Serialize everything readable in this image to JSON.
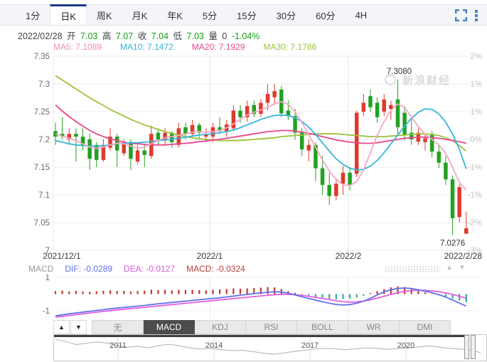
{
  "tabbar": {
    "tabs": [
      "1分",
      "日K",
      "周K",
      "月K",
      "年K",
      "5分",
      "15分",
      "30分",
      "60分",
      "4H"
    ],
    "active_index": 1
  },
  "icons": {
    "fullscreen": "fullscreen-icon",
    "menu": "kebab-menu-icon",
    "color": "#4b80c2"
  },
  "info_bar": {
    "date": "2022/02/28",
    "open_label": "开",
    "open": "7.03",
    "high_label": "高",
    "high": "7.07",
    "close_label": "收",
    "close": "7.04",
    "low_label": "低",
    "low": "7.03",
    "volume_label": "量",
    "volume": "0",
    "change": "-1.04%"
  },
  "ma_legend": [
    {
      "text": "MA5: 7.1089",
      "color": "#f08cb4"
    },
    {
      "text": "MA10: 7.1472",
      "color": "#34b3da"
    },
    {
      "text": "MA20: 7.1929",
      "color": "#e8468c"
    },
    {
      "text": "MA30: 7.1786",
      "color": "#9cc33c"
    }
  ],
  "chart_data": {
    "type": "candlestick",
    "y_axis_left": [
      "7.35",
      "7.3",
      "7.25",
      "7.2",
      "7.15",
      "7.1",
      "7.05",
      "7"
    ],
    "y_axis_right": [
      "2%",
      "1%",
      "1%",
      "0%",
      "-1%",
      "-1%",
      "-2%",
      "-3%"
    ],
    "price_top": 7.35,
    "price_bottom": 7.0,
    "x_labels": [
      "2021/12/1",
      "2022/1",
      "2022/2",
      "2022/2/28"
    ],
    "watermark": "新浪财经",
    "annotation_high": {
      "text": "7.3080",
      "index": 50,
      "value": 7.308
    },
    "annotation_low": {
      "text": "7.0276",
      "index": 58,
      "value": 7.0276
    },
    "colors": {
      "up": "#df3a2e",
      "down": "#22a122",
      "ma5": "#f5a8c4",
      "ma10": "#38b4dc",
      "ma20": "#e8468c",
      "ma30": "#9cc33c"
    },
    "candles": [
      [
        7.215,
        7.23,
        7.19,
        7.205
      ],
      [
        7.21,
        7.24,
        7.2,
        7.205
      ],
      [
        7.2,
        7.22,
        7.19,
        7.21
      ],
      [
        7.21,
        7.22,
        7.16,
        7.205
      ],
      [
        7.205,
        7.22,
        7.18,
        7.19
      ],
      [
        7.2,
        7.21,
        7.145,
        7.165
      ],
      [
        7.19,
        7.195,
        7.15,
        7.163
      ],
      [
        7.163,
        7.2,
        7.16,
        7.19
      ],
      [
        7.185,
        7.22,
        7.18,
        7.205
      ],
      [
        7.205,
        7.21,
        7.15,
        7.18
      ],
      [
        7.175,
        7.2,
        7.17,
        7.195
      ],
      [
        7.195,
        7.2,
        7.145,
        7.165
      ],
      [
        7.16,
        7.19,
        7.155,
        7.18
      ],
      [
        7.18,
        7.19,
        7.15,
        7.172
      ],
      [
        7.17,
        7.225,
        7.165,
        7.21
      ],
      [
        7.212,
        7.22,
        7.19,
        7.2
      ],
      [
        7.198,
        7.22,
        7.19,
        7.212
      ],
      [
        7.212,
        7.215,
        7.185,
        7.195
      ],
      [
        7.19,
        7.23,
        7.185,
        7.22
      ],
      [
        7.222,
        7.23,
        7.2,
        7.21
      ],
      [
        7.21,
        7.235,
        7.205,
        7.226
      ],
      [
        7.226,
        7.23,
        7.2,
        7.212
      ],
      [
        7.205,
        7.22,
        7.195,
        7.208
      ],
      [
        7.205,
        7.23,
        7.195,
        7.222
      ],
      [
        7.222,
        7.24,
        7.21,
        7.215
      ],
      [
        7.215,
        7.235,
        7.205,
        7.227
      ],
      [
        7.22,
        7.262,
        7.215,
        7.252
      ],
      [
        7.252,
        7.262,
        7.23,
        7.24
      ],
      [
        7.24,
        7.27,
        7.232,
        7.26
      ],
      [
        7.262,
        7.27,
        7.24,
        7.246
      ],
      [
        7.246,
        7.272,
        7.24,
        7.266
      ],
      [
        7.266,
        7.3,
        7.252,
        7.282
      ],
      [
        7.276,
        7.3,
        7.262,
        7.287
      ],
      [
        7.29,
        7.296,
        7.24,
        7.247
      ],
      [
        7.252,
        7.27,
        7.235,
        7.242
      ],
      [
        7.242,
        7.255,
        7.2,
        7.212
      ],
      [
        7.212,
        7.22,
        7.17,
        7.182
      ],
      [
        7.18,
        7.2,
        7.16,
        7.19
      ],
      [
        7.19,
        7.195,
        7.125,
        7.148
      ],
      [
        7.148,
        7.17,
        7.1,
        7.118
      ],
      [
        7.118,
        7.14,
        7.082,
        7.098
      ],
      [
        7.098,
        7.13,
        7.09,
        7.12
      ],
      [
        7.12,
        7.152,
        7.1,
        7.14
      ],
      [
        7.14,
        7.15,
        7.108,
        7.118
      ],
      [
        7.138,
        7.252,
        7.132,
        7.248
      ],
      [
        7.25,
        7.282,
        7.242,
        7.266
      ],
      [
        7.278,
        7.29,
        7.25,
        7.258
      ],
      [
        7.266,
        7.276,
        7.23,
        7.24
      ],
      [
        7.25,
        7.282,
        7.242,
        7.272
      ],
      [
        7.255,
        7.27,
        7.235,
        7.262
      ],
      [
        7.272,
        7.308,
        7.21,
        7.222
      ],
      [
        7.248,
        7.26,
        7.198,
        7.208
      ],
      [
        7.212,
        7.24,
        7.19,
        7.2
      ],
      [
        7.196,
        7.22,
        7.19,
        7.212
      ],
      [
        7.195,
        7.21,
        7.18,
        7.202
      ],
      [
        7.21,
        7.215,
        7.168,
        7.178
      ],
      [
        7.178,
        7.19,
        7.148,
        7.158
      ],
      [
        7.158,
        7.17,
        7.118,
        7.128
      ],
      [
        7.128,
        7.135,
        7.0276,
        7.058
      ],
      [
        7.06,
        7.12,
        7.05,
        7.114
      ],
      [
        7.03,
        7.07,
        7.03,
        7.04
      ]
    ],
    "ma5": [
      7.21,
      7.206,
      7.202,
      7.198,
      7.192,
      7.186,
      7.184,
      7.186,
      7.19,
      7.193,
      7.192,
      7.188,
      7.184,
      7.186,
      7.192,
      7.198,
      7.203,
      7.205,
      7.207,
      7.21,
      7.213,
      7.214,
      7.213,
      7.214,
      7.216,
      7.221,
      7.228,
      7.236,
      7.244,
      7.249,
      7.253,
      7.258,
      7.264,
      7.268,
      7.263,
      7.25,
      7.23,
      7.208,
      7.186,
      7.163,
      7.143,
      7.128,
      7.118,
      7.117,
      7.124,
      7.145,
      7.176,
      7.208,
      7.232,
      7.252,
      7.264,
      7.257,
      7.241,
      7.223,
      7.209,
      7.2,
      7.19,
      7.175,
      7.15,
      7.122,
      7.109
    ],
    "ma10": [
      7.198,
      7.195,
      7.192,
      7.19,
      7.189,
      7.188,
      7.188,
      7.189,
      7.19,
      7.192,
      7.193,
      7.194,
      7.194,
      7.195,
      7.196,
      7.198,
      7.199,
      7.2,
      7.202,
      7.204,
      7.206,
      7.208,
      7.209,
      7.21,
      7.212,
      7.214,
      7.217,
      7.221,
      7.226,
      7.231,
      7.236,
      7.24,
      7.243,
      7.244,
      7.243,
      7.239,
      7.232,
      7.222,
      7.209,
      7.194,
      7.179,
      7.165,
      7.155,
      7.148,
      7.145,
      7.146,
      7.152,
      7.162,
      7.176,
      7.192,
      7.208,
      7.224,
      7.238,
      7.249,
      7.255,
      7.254,
      7.246,
      7.231,
      7.21,
      7.182,
      7.147
    ],
    "ma20": [
      7.262,
      7.251,
      7.241,
      7.232,
      7.224,
      7.216,
      7.21,
      7.205,
      7.201,
      7.198,
      7.195,
      7.193,
      7.192,
      7.191,
      7.19,
      7.19,
      7.19,
      7.191,
      7.192,
      7.193,
      7.194,
      7.196,
      7.197,
      7.199,
      7.2,
      7.202,
      7.204,
      7.206,
      7.208,
      7.21,
      7.212,
      7.214,
      7.215,
      7.216,
      7.216,
      7.215,
      7.213,
      7.211,
      7.208,
      7.205,
      7.202,
      7.199,
      7.197,
      7.195,
      7.194,
      7.193,
      7.193,
      7.194,
      7.196,
      7.198,
      7.2,
      7.202,
      7.203,
      7.204,
      7.204,
      7.203,
      7.202,
      7.2,
      7.198,
      7.196,
      7.193
    ],
    "ma30": [
      7.315,
      7.307,
      7.299,
      7.291,
      7.283,
      7.275,
      7.268,
      7.261,
      7.254,
      7.248,
      7.242,
      7.236,
      7.231,
      7.226,
      7.222,
      7.218,
      7.214,
      7.211,
      7.208,
      7.205,
      7.203,
      7.201,
      7.2,
      7.199,
      7.198,
      7.198,
      7.198,
      7.198,
      7.199,
      7.2,
      7.201,
      7.202,
      7.203,
      7.205,
      7.206,
      7.207,
      7.208,
      7.209,
      7.21,
      7.21,
      7.21,
      7.21,
      7.209,
      7.208,
      7.207,
      7.206,
      7.205,
      7.205,
      7.205,
      7.206,
      7.207,
      7.208,
      7.209,
      7.21,
      7.21,
      7.209,
      7.207,
      7.203,
      7.198,
      7.189,
      7.179
    ]
  },
  "macd_panel": {
    "name": "MACD",
    "items": [
      {
        "text": "DIF: -0.0289",
        "color": "#6070e8"
      },
      {
        "text": "DEA: -0.0127",
        "color": "#d65ce0"
      },
      {
        "text": "MACD: -0.0324",
        "color": "#b24040"
      }
    ],
    "up_triangle": "▲",
    "down_triangle": "▼",
    "y_labels": [
      "1",
      "-1"
    ],
    "colors": {
      "hist_pos": "#bf3a30",
      "hist_neg": "#2ea99c",
      "dif": "#6072e8",
      "dea": "#e55ce0"
    },
    "hist": [
      0.18,
      0.2,
      0.16,
      0.19,
      0.15,
      0.13,
      0.16,
      0.2,
      0.22,
      0.18,
      0.2,
      0.15,
      0.18,
      0.2,
      0.26,
      0.24,
      0.26,
      0.22,
      0.26,
      0.24,
      0.26,
      0.24,
      0.22,
      0.26,
      0.28,
      0.3,
      0.34,
      0.32,
      0.34,
      0.36,
      0.38,
      0.42,
      0.4,
      0.3,
      0.18,
      0.08,
      -0.06,
      -0.1,
      -0.16,
      -0.22,
      -0.28,
      -0.32,
      -0.3,
      -0.26,
      -0.2,
      -0.1,
      0.06,
      0.18,
      0.3,
      0.4,
      0.46,
      0.42,
      0.34,
      0.22,
      0.1,
      0.02,
      -0.06,
      -0.14,
      -0.26,
      -0.38,
      -0.48
    ],
    "dif": [
      -1.3,
      -1.24,
      -1.18,
      -1.13,
      -1.08,
      -1.03,
      -0.98,
      -0.93,
      -0.88,
      -0.84,
      -0.8,
      -0.76,
      -0.72,
      -0.68,
      -0.63,
      -0.58,
      -0.54,
      -0.5,
      -0.46,
      -0.42,
      -0.38,
      -0.34,
      -0.3,
      -0.26,
      -0.22,
      -0.17,
      -0.12,
      -0.07,
      -0.02,
      0.03,
      0.07,
      0.11,
      0.14,
      0.12,
      0.05,
      -0.05,
      -0.16,
      -0.26,
      -0.36,
      -0.46,
      -0.55,
      -0.62,
      -0.65,
      -0.63,
      -0.55,
      -0.42,
      -0.25,
      -0.05,
      0.13,
      0.26,
      0.34,
      0.36,
      0.33,
      0.26,
      0.17,
      0.08,
      -0.04,
      -0.18,
      -0.35,
      -0.54,
      -0.72
    ],
    "dea": [
      -1.38,
      -1.33,
      -1.28,
      -1.23,
      -1.18,
      -1.13,
      -1.08,
      -1.04,
      -0.99,
      -0.95,
      -0.91,
      -0.87,
      -0.83,
      -0.79,
      -0.75,
      -0.71,
      -0.67,
      -0.63,
      -0.59,
      -0.55,
      -0.51,
      -0.47,
      -0.43,
      -0.39,
      -0.35,
      -0.31,
      -0.27,
      -0.23,
      -0.19,
      -0.15,
      -0.11,
      -0.07,
      -0.04,
      -0.02,
      -0.02,
      -0.04,
      -0.08,
      -0.13,
      -0.19,
      -0.26,
      -0.33,
      -0.4,
      -0.45,
      -0.48,
      -0.47,
      -0.42,
      -0.34,
      -0.24,
      -0.13,
      -0.02,
      0.08,
      0.16,
      0.21,
      0.23,
      0.22,
      0.19,
      0.14,
      0.07,
      -0.02,
      -0.13,
      -0.25
    ]
  },
  "indicator_bar": {
    "up": "▲",
    "down": "▼",
    "tabs": [
      "无",
      "MACD",
      "KDJ",
      "RSI",
      "BOLL",
      "WR",
      "DMI"
    ],
    "active": "MACD"
  },
  "scrubber": {
    "years": [
      "2011",
      "2014",
      "2017",
      "2020"
    ],
    "spark": [
      0.1,
      0.22,
      0.38,
      0.3,
      0.24,
      0.3,
      0.44,
      0.5,
      0.46,
      0.54,
      0.42,
      0.36,
      0.44,
      0.54,
      0.6,
      0.57,
      0.63,
      0.68,
      0.66,
      0.72,
      0.8,
      0.86,
      0.8,
      0.72,
      0.66,
      0.6,
      0.56,
      0.59,
      0.63,
      0.59,
      0.54,
      0.56,
      0.61,
      0.58,
      0.55,
      0.5,
      0.44,
      0.5,
      0.56,
      0.6,
      0.66,
      0.78
    ]
  }
}
